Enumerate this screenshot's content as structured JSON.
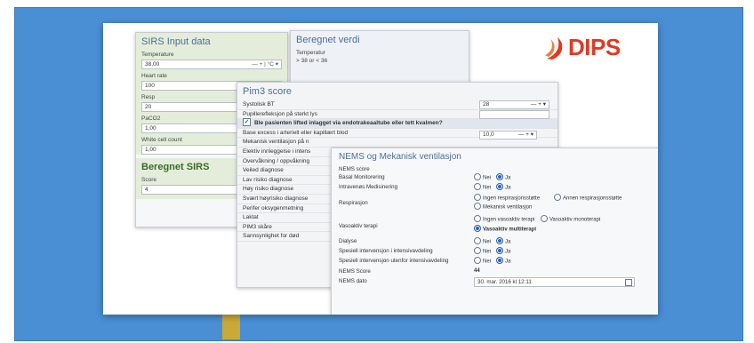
{
  "logo": {
    "text": "DIPS",
    "color": "#e03a24"
  },
  "panel_color": "#4a8fd4",
  "sirs": {
    "title": "SIRS Input data",
    "fields": [
      {
        "label": "Temperature",
        "value": "38,00",
        "controls": "— + | °C ▾"
      },
      {
        "label": "Heart rate",
        "value": "100"
      },
      {
        "label": "Resp",
        "value": "20"
      },
      {
        "label": "PaCO2",
        "value": "1,00"
      },
      {
        "label": "White cell count",
        "value": "1,00"
      }
    ],
    "result_title": "Beregnet SIRS",
    "score_label": "Score",
    "score_value": "4"
  },
  "beregnet": {
    "title": "Beregnet verdi",
    "label": "Temperatur",
    "value": "> 38 or < 36"
  },
  "pim": {
    "title": "Pim3 score",
    "rows": [
      "Systolisk BT",
      "Pupillerefleksjon på sterkt lys",
      "Ble pasienten lifted inlagget via endotrakeaaltube eller tett kvalmen?",
      "Base excess i arterielt eller kapillært blod",
      "Mekanisk ventilasjon på n",
      "Elektiv innleggelse i intens",
      "Overvåkning / oppvåkning",
      "Veiled diagnose",
      "Lav risiko diagnose",
      "Høy risiko diagnose",
      "Svært høyrisiko diagnose",
      "Perifer oksygenmetning",
      "Laktat",
      "PIM3 skåre",
      "Sannsynlighet for død"
    ],
    "systolic_value": "28",
    "systolic_controls": "— + ▾",
    "base_excess_value": "10,0",
    "base_excess_controls": "— + ▾"
  },
  "nems": {
    "title": "NEMS og Mekanisk ventilasjon",
    "rows": [
      {
        "label": "NEMS score"
      },
      {
        "label": "Basal Monitorering",
        "options": [
          "Nei",
          "Ja"
        ],
        "selected": 1
      },
      {
        "label": "Intravenøs Medisinering",
        "options": [
          "Nei",
          "Ja"
        ],
        "selected": 1
      },
      {
        "label": "Respirasjon",
        "options": [
          "Ingen respirasjonsstøtte",
          "Annen respirasjonsstøtte",
          "Mekanisk ventilasjon"
        ],
        "selected": -1
      },
      {
        "label": "Vasoaktiv terapi",
        "options": [
          "Ingen vasoaktiv terapi",
          "Vasoaktiv monoterapi",
          "Vasoaktiv multiterapi"
        ],
        "selected": 2
      },
      {
        "label": "Dialyse",
        "options": [
          "Nei",
          "Ja"
        ],
        "selected": 1
      },
      {
        "label": "Spesiell intervensjon i intensivavdeling",
        "options": [
          "Nei",
          "Ja"
        ],
        "selected": 1
      },
      {
        "label": "Spesiell intervensjon utenfor intensivavdeling",
        "options": [
          "Nei",
          "Ja"
        ],
        "selected": 1
      },
      {
        "label": "NEMS Score",
        "value": "44"
      },
      {
        "label": "NEMS dato",
        "value": "30. mar. 2016 kl 12:11"
      }
    ]
  }
}
